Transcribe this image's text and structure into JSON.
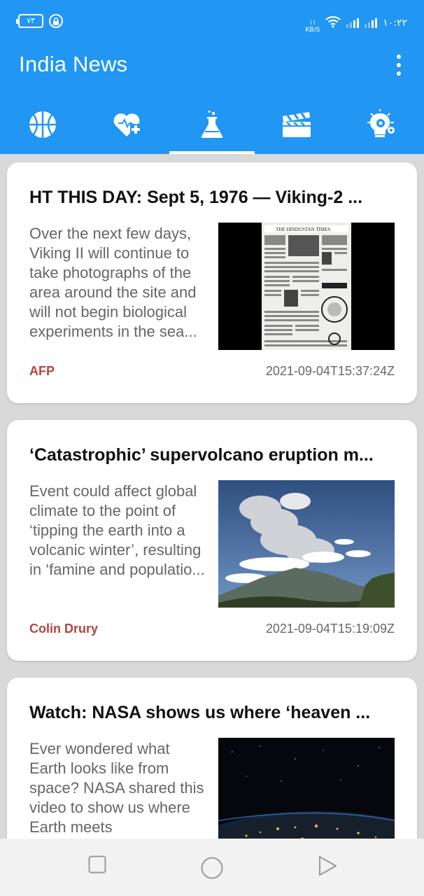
{
  "status_bar": {
    "battery": "٧٣",
    "net_speed_top": "١١",
    "net_speed_unit": "KB/S",
    "time": "١٠:٢٢"
  },
  "app": {
    "title": "India News",
    "accent_color": "#2196f3",
    "source_color": "#b5443f"
  },
  "tabs": [
    {
      "icon": "basketball-icon",
      "active": false
    },
    {
      "icon": "heart-plus-icon",
      "active": false
    },
    {
      "icon": "flask-icon",
      "active": true
    },
    {
      "icon": "clapperboard-icon",
      "active": false
    },
    {
      "icon": "lightbulb-gear-icon",
      "active": false
    }
  ],
  "articles": [
    {
      "title": "HT THIS DAY: Sept 5, 1976 — Viking-2 ...",
      "description": "Over the next few days, Viking II will continue to take photographs of the area around the site and will not begin biological experiments in the sea...",
      "source": "AFP",
      "date": "2021-09-04T15:37:24Z",
      "image": "newspaper-page-image"
    },
    {
      "title": "‘Catastrophic’ supervolcano eruption m...",
      "description": "Event could affect global climate to the point of ‘tipping the earth into a volcanic winter’, resulting in ‘famine and populatio...",
      "source": "Colin Drury",
      "date": "2021-09-04T15:19:09Z",
      "image": "volcano-eruption-image"
    },
    {
      "title": "Watch: NASA shows us where ‘heaven ...",
      "description": "Ever wondered what Earth looks like from space? NASA shared this video to show us where Earth meets",
      "source": "",
      "date": "",
      "image": "earth-from-space-image"
    }
  ],
  "nav_bar": {
    "buttons": [
      "recent-apps-button",
      "home-button",
      "back-button"
    ]
  }
}
